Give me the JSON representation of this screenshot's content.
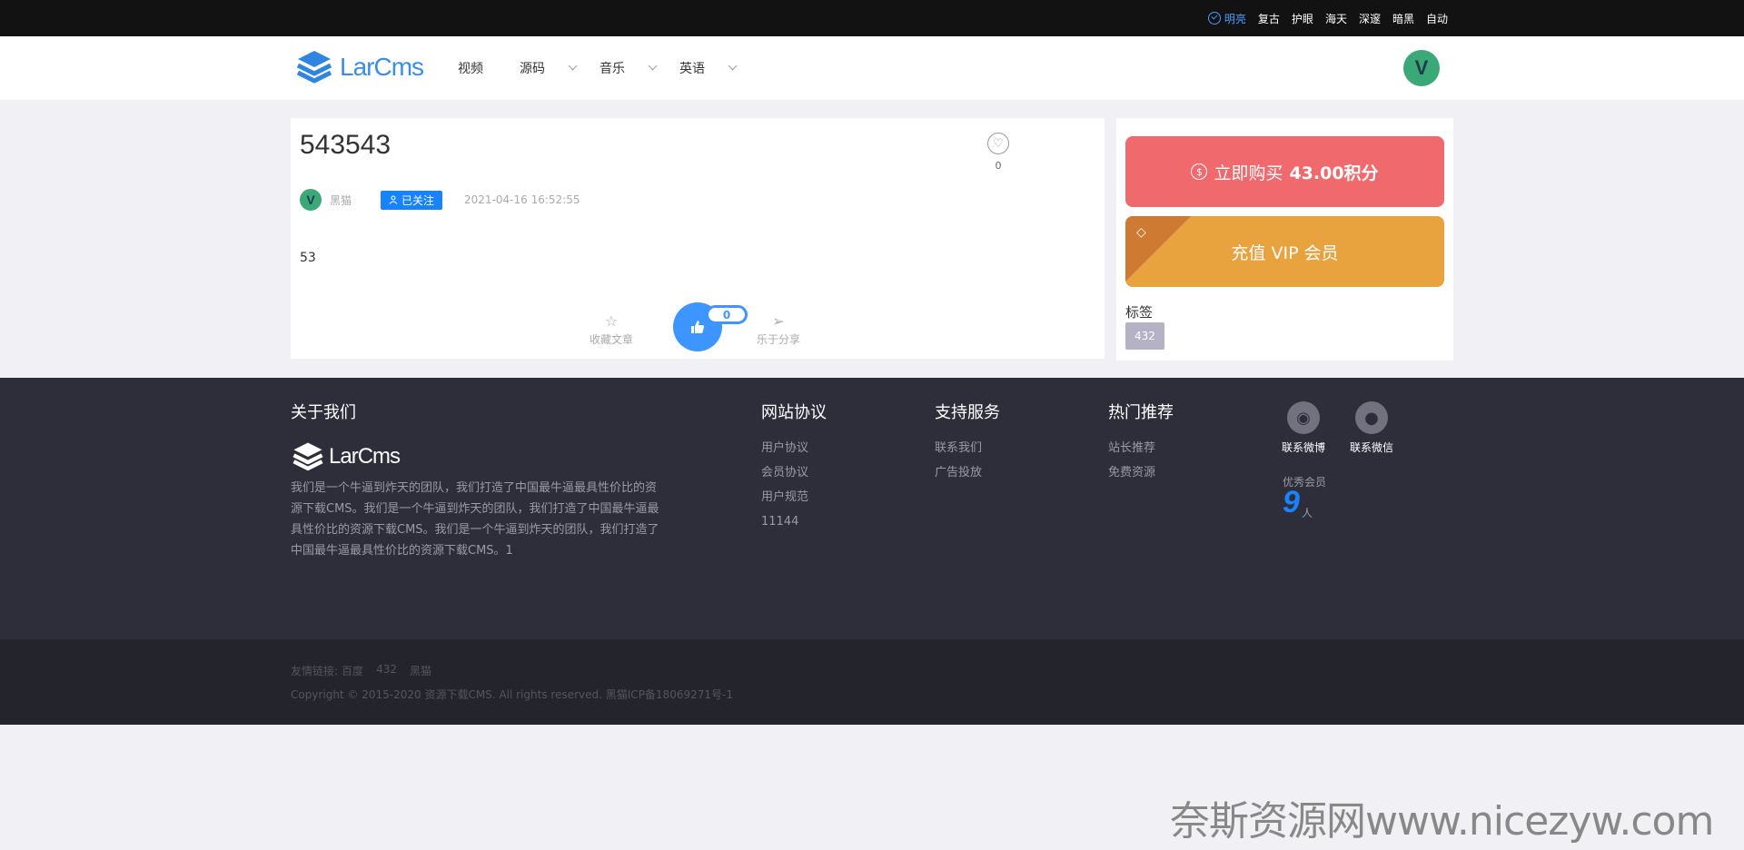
{
  "theme_bar": {
    "themes": [
      {
        "label": "明亮",
        "active": true
      },
      {
        "label": "复古",
        "active": false
      },
      {
        "label": "护眼",
        "active": false
      },
      {
        "label": "海天",
        "active": false
      },
      {
        "label": "深邃",
        "active": false
      },
      {
        "label": "暗黑",
        "active": false
      },
      {
        "label": "自动",
        "active": false
      }
    ]
  },
  "header": {
    "logo_text": "LarCms",
    "nav": [
      {
        "label": "视频",
        "has_dropdown": false
      },
      {
        "label": "源码",
        "has_dropdown": true
      },
      {
        "label": "音乐",
        "has_dropdown": true
      },
      {
        "label": "英语",
        "has_dropdown": true
      }
    ],
    "avatar_letter": "V"
  },
  "article": {
    "title": "543543",
    "favorite_count": "0",
    "author_avatar_letter": "V",
    "author": "黑猫",
    "follow_label": "已关注",
    "time": "2021-04-16 16:52:55",
    "body": "53",
    "collect_label": "收藏文章",
    "like_count": "0",
    "share_label": "乐于分享"
  },
  "sidebar": {
    "buy_label": "立即购买",
    "buy_points": "43.00积分",
    "vip_label": "充值 VIP 会员",
    "tags_title": "标签",
    "tags": [
      "432"
    ]
  },
  "footer": {
    "about_title": "关于我们",
    "logo_text": "LarCms",
    "about_desc": "我们是一个牛逼到炸天的团队，我们打造了中国最牛逼最具性价比的资源下载CMS。我们是一个牛逼到炸天的团队，我们打造了中国最牛逼最具性价比的资源下载CMS。我们是一个牛逼到炸天的团队，我们打造了中国最牛逼最具性价比的资源下载CMS。1",
    "columns": [
      {
        "title": "网站协议",
        "links": [
          "用户协议",
          "会员协议",
          "用户规范",
          "11144"
        ]
      },
      {
        "title": "支持服务",
        "links": [
          "联系我们",
          "广告投放"
        ]
      },
      {
        "title": "热门推荐",
        "links": [
          "站长推荐",
          "免费资源"
        ]
      }
    ],
    "contact_weibo": "联系微博",
    "contact_wechat": "联系微信",
    "vip_members_label": "优秀会员",
    "vip_members_count": "9",
    "vip_members_unit": "人"
  },
  "bottom": {
    "friend_links_label": "友情链接:",
    "friend_links": [
      "百度",
      "432",
      "黑猫"
    ],
    "copyright": "Copyright © 2015-2020 资源下载CMS. All rights reserved. 黑猫ICP备18069271号-1"
  },
  "watermark": "奈斯资源网www.nicezyw.com",
  "colors": {
    "accent": "#1783ff",
    "buy": "#f06a6d",
    "vip": "#e8a23e",
    "footer_bg": "#2e2e3b"
  }
}
